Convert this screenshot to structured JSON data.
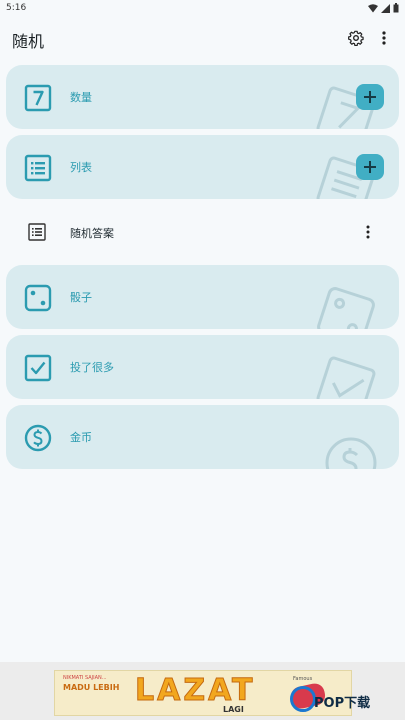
{
  "status_bar": {
    "time": "5:16"
  },
  "app_bar": {
    "title": "随机"
  },
  "items": [
    {
      "label": "数量",
      "icon_text": "7",
      "icon": "number-seven-icon",
      "has_add": true
    },
    {
      "label": "列表",
      "icon": "list-icon",
      "has_add": true
    },
    {
      "label": "随机答案",
      "icon": "list-outline-icon"
    },
    {
      "label": "骰子",
      "icon": "dice-icon"
    },
    {
      "label": "投了很多",
      "icon": "checkbox-icon"
    },
    {
      "label": "金币",
      "icon": "dollar-coin-icon"
    }
  ],
  "ad": {
    "small_text": "NIKMATI SAJIAN...",
    "headline": "MADU LEBIH",
    "big_text": "LAZAT",
    "tail_text": "LAGI",
    "brand": "Famous"
  },
  "watermark": {
    "text": "POP下载"
  },
  "colors": {
    "accent": "#2b9bb0",
    "card_bg": "#d9ebef",
    "add_button": "#41aec4"
  }
}
